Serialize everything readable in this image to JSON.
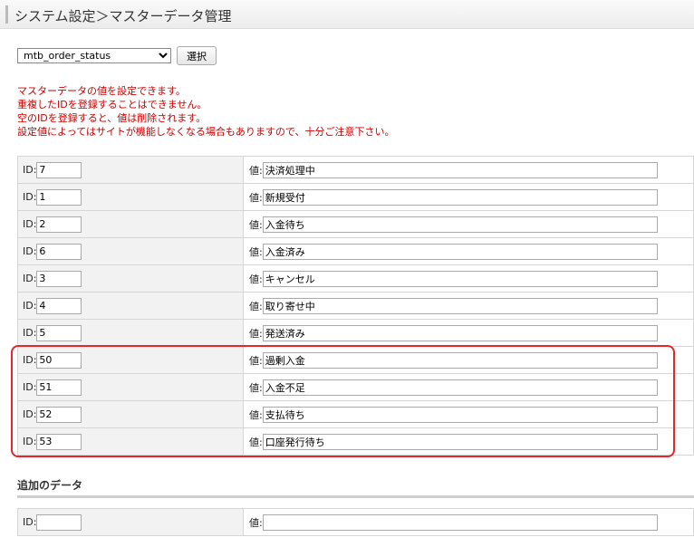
{
  "header": {
    "title": "システム設定＞マスターデータ管理"
  },
  "master_select": {
    "value": "mtb_order_status",
    "button_label": "選択"
  },
  "notice": [
    "マスターデータの値を設定できます。",
    "重複したIDを登録することはできません。",
    "空のIDを登録すると、値は削除されます。",
    "設定値によってはサイトが機能しなくなる場合もありますので、十分ご注意下さい。"
  ],
  "labels": {
    "id": "ID:",
    "value": "値:"
  },
  "rows": [
    {
      "id": "7",
      "value": "決済処理中"
    },
    {
      "id": "1",
      "value": "新規受付"
    },
    {
      "id": "2",
      "value": "入金待ち"
    },
    {
      "id": "6",
      "value": "入金済み"
    },
    {
      "id": "3",
      "value": "キャンセル"
    },
    {
      "id": "4",
      "value": "取り寄せ中"
    },
    {
      "id": "5",
      "value": "発送済み"
    },
    {
      "id": "50",
      "value": "過剰入金"
    },
    {
      "id": "51",
      "value": "入金不足"
    },
    {
      "id": "52",
      "value": "支払待ち"
    },
    {
      "id": "53",
      "value": "口座発行待ち"
    }
  ],
  "add_section": {
    "title": "追加のデータ",
    "id": "",
    "value": ""
  },
  "colors": {
    "notice": "#cc0000",
    "highlight": "#e8252b"
  }
}
